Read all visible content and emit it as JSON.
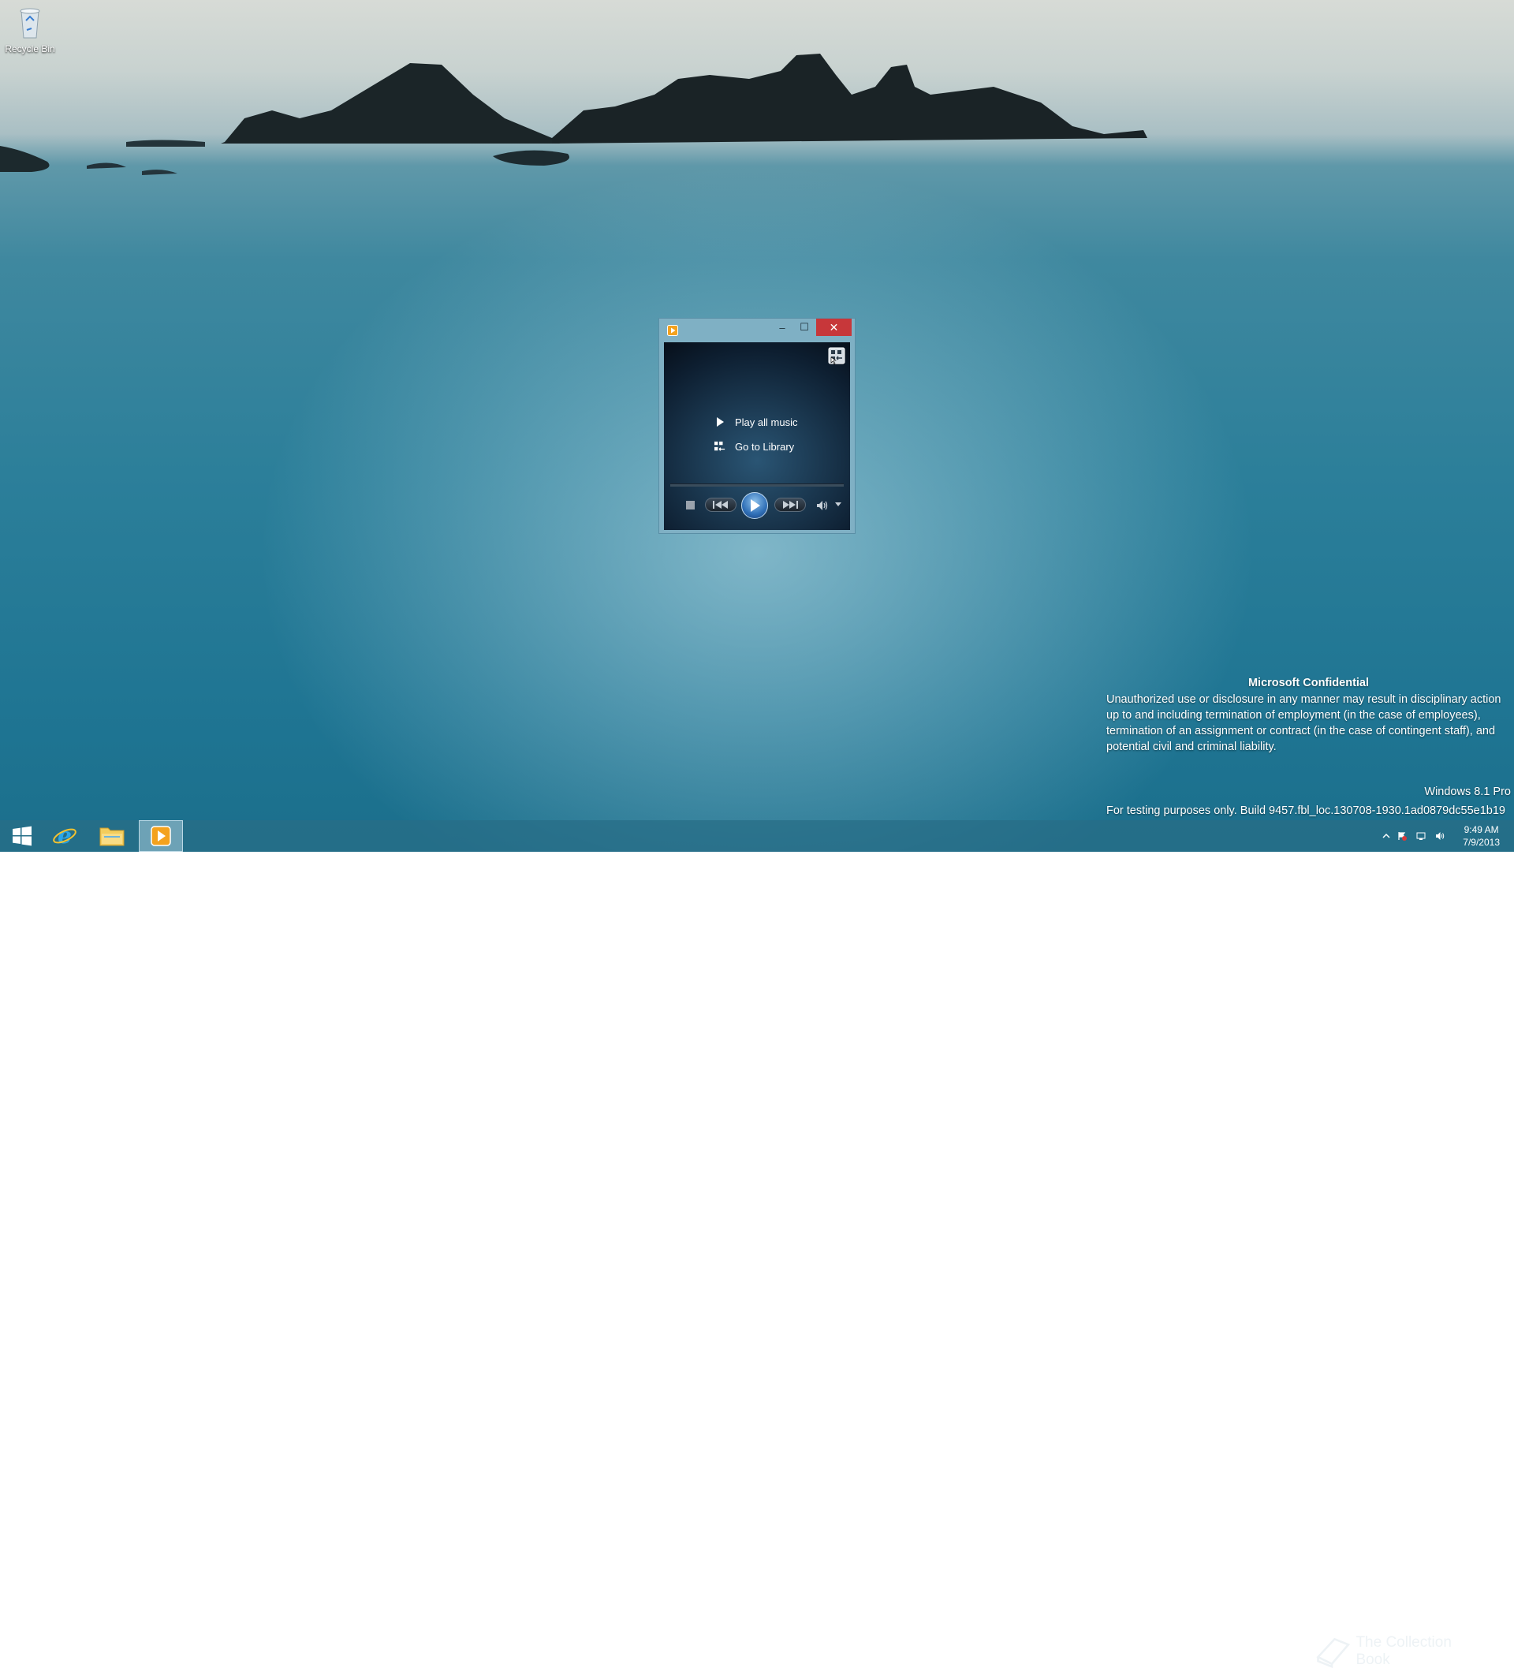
{
  "desktop": {
    "recycle_bin_label": "Recycle Bin"
  },
  "wmp": {
    "title": "",
    "minimize_glyph": "–",
    "maximize_glyph": "☐",
    "close_glyph": "✕",
    "menu": [
      {
        "label": "Play all music",
        "icon": "play-icon"
      },
      {
        "label": "Go to Library",
        "icon": "library-icon"
      }
    ],
    "seek_progress": 0
  },
  "confidential": {
    "title": "Microsoft Confidential",
    "body": "Unauthorized use or disclosure in any manner may result in disciplinary action up to and including termination of employment (in the case of employees), termination of an assignment or contract (in the case of contingent staff), and potential civil and criminal liability."
  },
  "edition": "Windows 8.1 Pro",
  "build": "For testing purposes only. Build 9457.fbl_loc.130708-1930.1ad0879dc55e1b19",
  "taskbar": {
    "items": [
      {
        "name": "start-button",
        "icon": "windows-logo-icon"
      },
      {
        "name": "internet-explorer",
        "icon": "ie-icon"
      },
      {
        "name": "file-explorer",
        "icon": "folder-icon"
      },
      {
        "name": "windows-media-player",
        "icon": "media-player-icon",
        "active": true
      }
    ],
    "watermark": "The Collection Book",
    "time": "9:49 AM",
    "date": "7/9/2013"
  },
  "colors": {
    "close_red": "#c7373a",
    "window_frame": "#7fb0c4",
    "taskbar": "#286e87"
  }
}
